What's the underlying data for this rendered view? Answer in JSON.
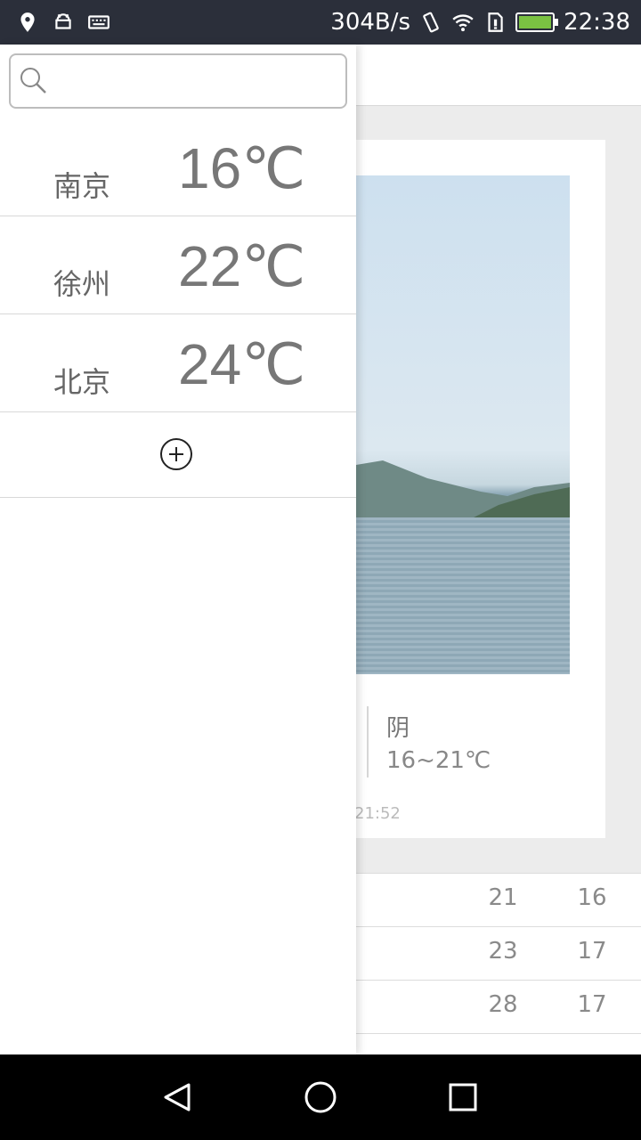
{
  "status_bar": {
    "speed": "304B/s",
    "time": "22:38",
    "icons": [
      "location-icon",
      "android-icon",
      "keyboard-icon",
      "vibrate-icon",
      "wifi-icon",
      "sim-icon",
      "battery-icon"
    ],
    "battery_color": "#7ac142"
  },
  "drawer": {
    "search": {
      "placeholder": ""
    },
    "cities": [
      {
        "name": "南京",
        "temp": "16℃"
      },
      {
        "name": "徐州",
        "temp": "22℃"
      },
      {
        "name": "北京",
        "temp": "24℃"
      }
    ],
    "add_icon": "plus-circle-icon"
  },
  "main": {
    "condition": "阴",
    "range": "16~21℃",
    "updated": "21:52",
    "forecast": [
      {
        "hi": "21",
        "lo": "16"
      },
      {
        "hi": "23",
        "lo": "17"
      },
      {
        "hi": "28",
        "lo": "17"
      }
    ]
  },
  "navbar": {
    "icons": [
      "back-icon",
      "home-icon",
      "recents-icon"
    ]
  }
}
